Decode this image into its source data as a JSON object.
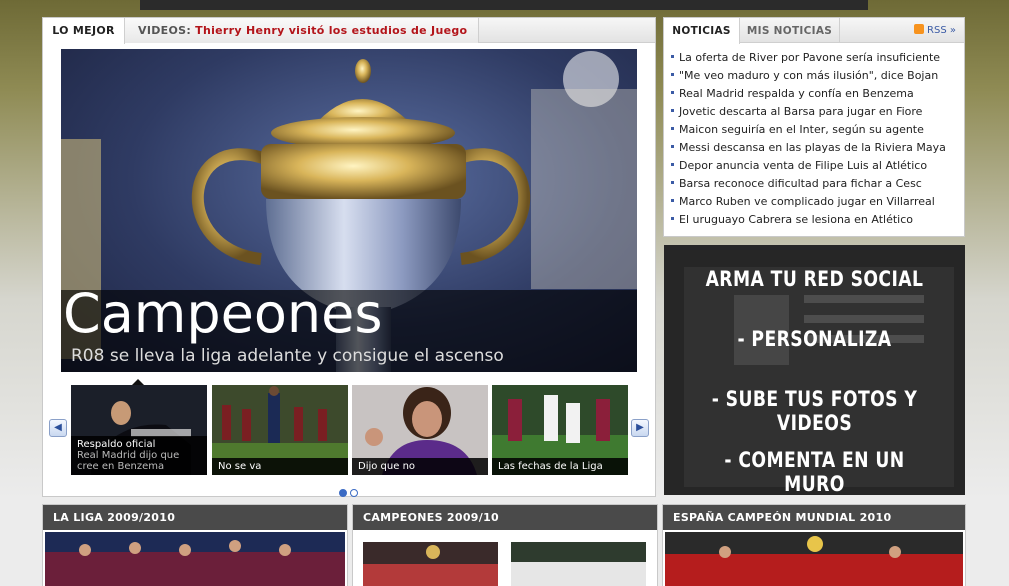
{
  "tabs": {
    "best": "LO MEJOR",
    "videos_label": "VIDEOS:",
    "videos_link": "Thierry Henry visitó los estudios de Juego Cruzado"
  },
  "hero": {
    "title": "Campeones",
    "subtitle": "R08 se lleva la liga adelante y consigue el ascenso"
  },
  "thumbs": [
    {
      "title": "Respaldo oficial",
      "subtitle": "Real Madrid dijo que cree en Benzema"
    },
    {
      "title": "No se va",
      "subtitle": ""
    },
    {
      "title": "Dijo que no",
      "subtitle": ""
    },
    {
      "title": "Las fechas de la Liga",
      "subtitle": ""
    }
  ],
  "carousel": {
    "prev": "◀",
    "next": "▶"
  },
  "news": {
    "tab_news": "NOTICIAS",
    "tab_mine": "MIS NOTICIAS",
    "rss": "RSS »",
    "items": [
      "La oferta de River por Pavone sería insuficiente",
      "\"Me veo maduro y con más ilusión\", dice Bojan",
      "Real Madrid respalda y confía en Benzema",
      "Jovetic descarta al Barsa para jugar en Fiore",
      "Maicon seguiría en el Inter, según su agente",
      "Messi descansa en las playas de la Riviera Maya",
      "Depor anuncia venta de Filipe Luis al Atlético",
      "Barsa reconoce dificultad para fichar a Cesc",
      "Marco Ruben ve complicado jugar en Villarreal",
      "El uruguayo Cabrera se lesiona en Atlético"
    ]
  },
  "banner": {
    "line1": "ARMA TU RED SOCIAL",
    "line2": "- PERSONALIZA",
    "line3": "- SUBE TUS FOTOS Y VIDEOS",
    "line4": "- COMENTA EN UN MURO"
  },
  "sections": {
    "liga": "LA LIGA 2009/2010",
    "campeones": "CAMPEONES 2009/10",
    "espana": "ESPAÑA CAMPEÓN MUNDIAL 2010"
  },
  "colors": {
    "accent_red": "#b3141a",
    "link_blue": "#3b5ba5",
    "section_header": "#4a4a4a"
  }
}
